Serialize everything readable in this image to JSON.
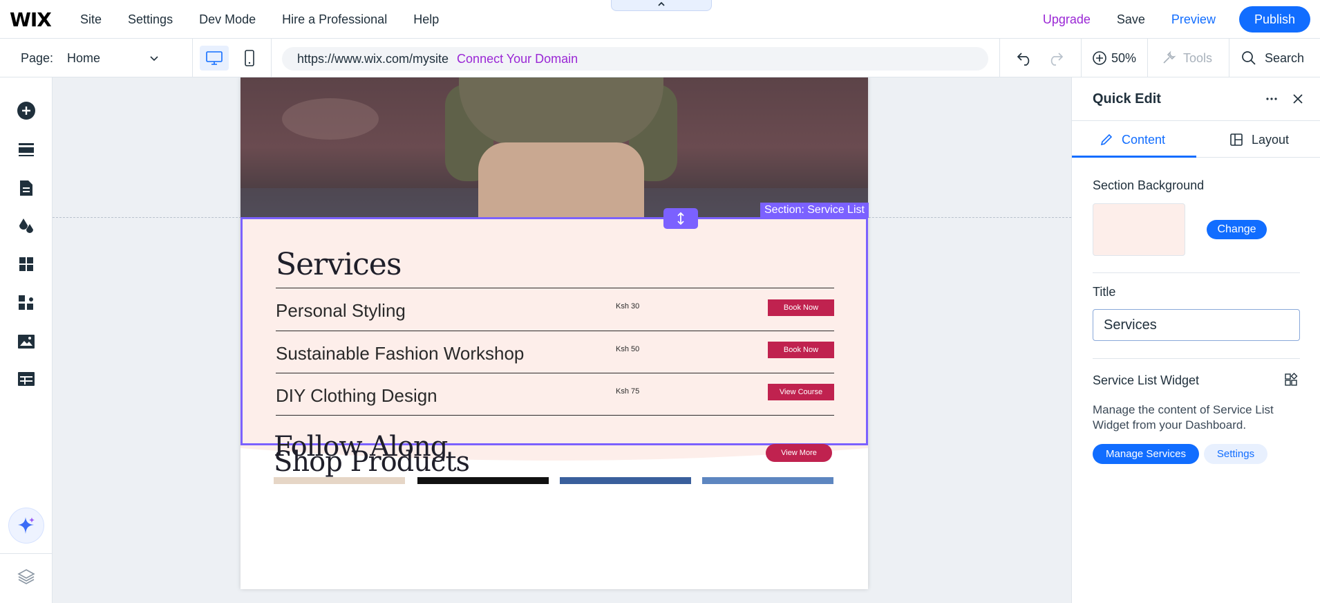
{
  "topbar": {
    "logo": "WIX",
    "menu": [
      "Site",
      "Settings",
      "Dev Mode",
      "Hire a Professional",
      "Help"
    ],
    "upgrade": "Upgrade",
    "save": "Save",
    "preview": "Preview",
    "publish": "Publish"
  },
  "subbar": {
    "page_label": "Page:",
    "page_name": "Home",
    "url": "https://www.wix.com/mysite",
    "connect_domain": "Connect Your Domain",
    "zoom": "50%",
    "tools": "Tools",
    "search": "Search"
  },
  "canvas": {
    "section_tag": "Section: Service List",
    "services_title": "Services",
    "services": [
      {
        "name": "Personal Styling",
        "price": "Ksh 30",
        "button": "Book Now"
      },
      {
        "name": "Sustainable Fashion Workshop",
        "price": "Ksh 50",
        "button": "Book Now"
      },
      {
        "name": "DIY Clothing Design",
        "price": "Ksh 75",
        "button": "View Course"
      }
    ],
    "follow_title": "Follow Along",
    "shop_title": "Shop Products",
    "view_more": "View More"
  },
  "panel": {
    "title": "Quick Edit",
    "tab_content": "Content",
    "tab_layout": "Layout",
    "section_background_label": "Section Background",
    "change_button": "Change",
    "title_label": "Title",
    "title_value": "Services",
    "widget_label": "Service List Widget",
    "widget_desc": "Manage the content of Service List Widget from your Dashboard.",
    "manage_services": "Manage Services",
    "settings": "Settings"
  },
  "colors": {
    "accent": "#116dff",
    "upgrade_purple": "#9a27d5",
    "selection": "#7b61ff",
    "section_bg": "#fdeeea",
    "cta": "#c0224f"
  }
}
